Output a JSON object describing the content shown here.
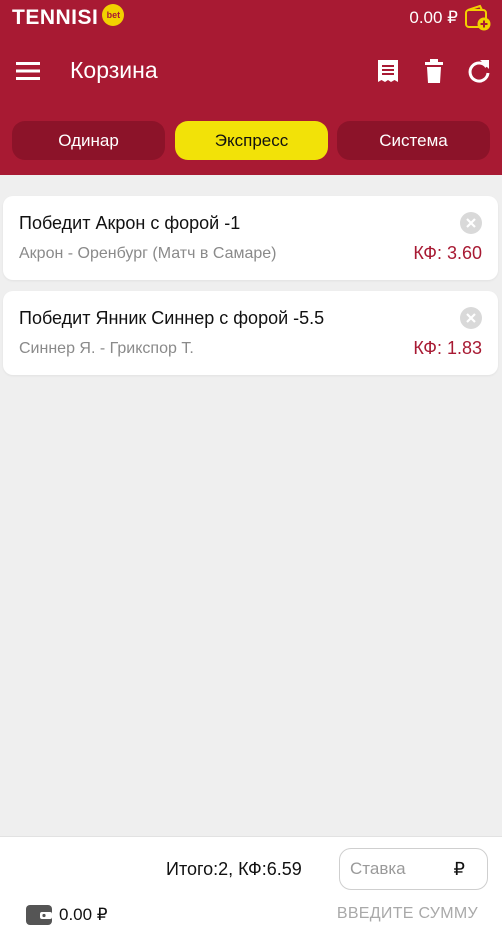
{
  "app": {
    "logo_text": "TENNISI",
    "logo_badge": "bet",
    "balance": "0.00 ₽"
  },
  "toolbar": {
    "title": "Корзина",
    "icons": [
      "menu-icon",
      "receipt-icon",
      "trash-icon",
      "refresh-icon"
    ]
  },
  "tabs": [
    {
      "label": "Одинар",
      "active": false
    },
    {
      "label": "Экспресс",
      "active": true
    },
    {
      "label": "Система",
      "active": false
    }
  ],
  "bets": [
    {
      "title": "Победит Акрон с форой -1",
      "match": "Акрон - Оренбург (Матч в Самаре)",
      "odds": "КФ: 3.60"
    },
    {
      "title": "Победит Янник Синнер с форой -5.5",
      "match": "Синнер Я. - Грикспор Т.",
      "odds": "КФ: 1.83"
    }
  ],
  "footer": {
    "total": "Итого:2, КФ:6.59",
    "stake_placeholder": "Ставка",
    "currency": "₽",
    "balance": "0.00 ₽",
    "submit_label": "ВВЕДИТЕ СУММУ"
  },
  "colors": {
    "brand": "#a81a33",
    "tab_inactive": "#8c1329",
    "tab_active": "#f2e208",
    "odds": "#a81a33"
  }
}
